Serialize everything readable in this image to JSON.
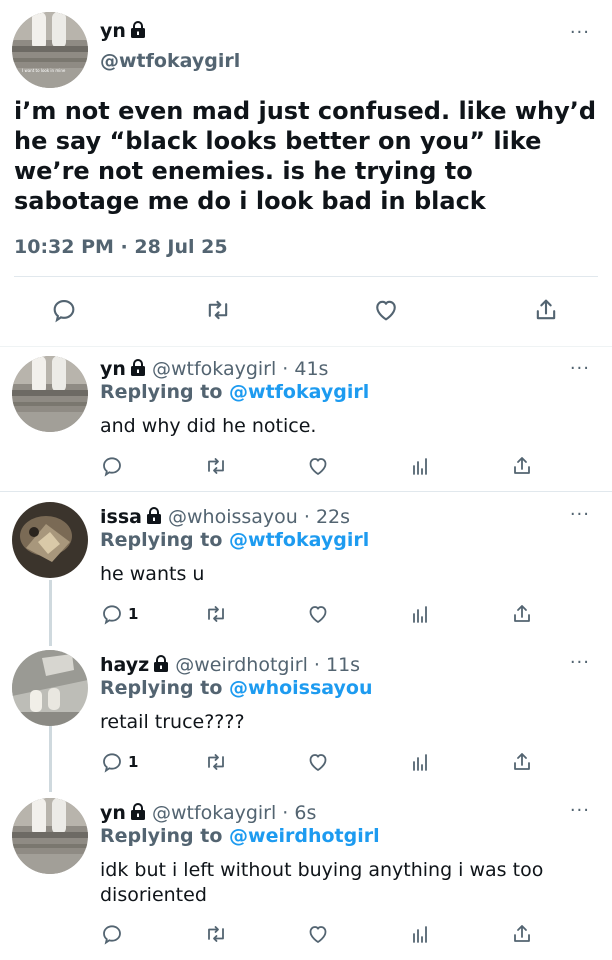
{
  "main_tweet": {
    "display_name": "yn",
    "handle": "@wtfokaygirl",
    "text": "i’m not even mad just confused. like why’d he say “black looks better on you” like we’re not enemies. is he trying to sabotage me do i look bad in black",
    "time": "10:32 PM · 28 Jul 25",
    "more_label": "···",
    "actions": [
      "reply-icon",
      "retweet-icon",
      "like-icon",
      "share-icon"
    ]
  },
  "replies": [
    {
      "display_name": "yn",
      "handle_time": "@wtfokaygirl · 41s",
      "replying_prefix": "Replying to",
      "replying_to": "@wtfokaygirl",
      "text": "and why did he notice.",
      "reply_count": ""
    },
    {
      "display_name": "issa",
      "handle_time": "@whoissayou · 22s",
      "replying_prefix": "Replying to",
      "replying_to": "@wtfokaygirl",
      "text": "he wants u",
      "reply_count": "1"
    },
    {
      "display_name": "hayz",
      "handle_time": "@weirdhotgirl · 11s",
      "replying_prefix": "Replying to",
      "replying_to": "@whoissayou",
      "text": "retail truce????",
      "reply_count": "1"
    },
    {
      "display_name": "yn",
      "handle_time": "@wtfokaygirl · 6s",
      "replying_prefix": "Replying to",
      "replying_to": "@weirdhotgirl",
      "text": "idk but i left without buying anything i was too disoriented",
      "reply_count": ""
    }
  ],
  "avatar_caption": "I want to look in mine",
  "colors": {
    "link": "#1d9bf0",
    "muted": "#536471",
    "text": "#0f1419",
    "divider": "#e1e8ed"
  }
}
